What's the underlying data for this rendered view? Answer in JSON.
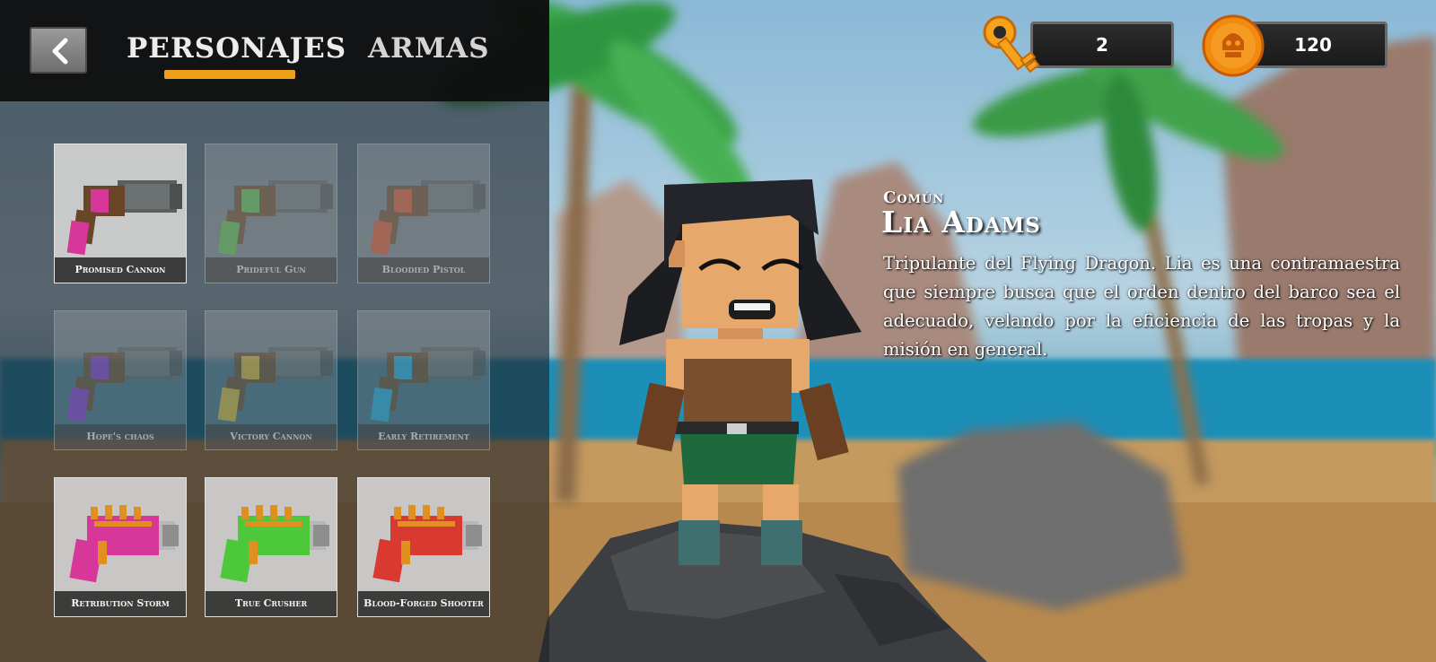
{
  "header": {
    "tabs": [
      {
        "label": "PERSONAJES",
        "active": true
      },
      {
        "label": "ARMAS",
        "active": false
      }
    ],
    "accent_color": "#f0a018"
  },
  "currencies": {
    "keys": {
      "icon": "key-icon",
      "value": "2"
    },
    "coins": {
      "icon": "skull-coin-icon",
      "value": "120"
    }
  },
  "weapons": [
    {
      "name": "Promised Cannon",
      "locked": false,
      "color": "#d8379a",
      "style": "cannon"
    },
    {
      "name": "Prideful Gun",
      "locked": true,
      "color": "#58b848",
      "style": "cannon"
    },
    {
      "name": "Bloodied Pistol",
      "locked": true,
      "color": "#d0502a",
      "style": "cannon"
    },
    {
      "name": "Hope's chaos",
      "locked": true,
      "color": "#8a38c8",
      "style": "cannon"
    },
    {
      "name": "Victory Cannon",
      "locked": true,
      "color": "#d8b032",
      "style": "cannon"
    },
    {
      "name": "Early Retirement",
      "locked": true,
      "color": "#2aa8d8",
      "style": "cannon"
    },
    {
      "name": "Retribution Storm",
      "locked": false,
      "color": "#d8379a",
      "style": "blaster"
    },
    {
      "name": "True Crusher",
      "locked": false,
      "color": "#4cc83a",
      "style": "blaster"
    },
    {
      "name": "Blood-Forged Shooter",
      "locked": false,
      "color": "#d83a32",
      "style": "blaster"
    }
  ],
  "character": {
    "rarity": "Común",
    "name": "Lia Adams",
    "description": "Tripulante del Flying Dragon. Lia es una contramaestra que siempre busca que el orden dentro del barco sea el adecuado, velando por la eficiencia de las tropas y la misión en general."
  }
}
